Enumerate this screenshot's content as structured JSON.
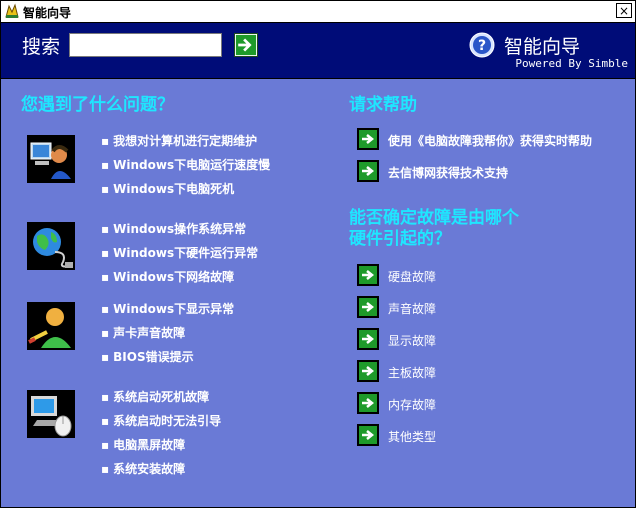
{
  "window": {
    "title": "智能向导",
    "close": "×"
  },
  "header": {
    "search_label": "搜索",
    "search_value": "",
    "search_placeholder": "",
    "brand": "智能向导",
    "powered_by": "Powered By Simble"
  },
  "problems": {
    "title": "您遇到了什么问题？",
    "groups": [
      {
        "items": [
          "我想对计算机进行定期维护",
          "Windows下电脑运行速度慢",
          "Windows下电脑死机"
        ]
      },
      {
        "items": [
          "Windows操作系统异常",
          "Windows下硬件运行异常",
          "Windows下网络故障"
        ]
      },
      {
        "items": [
          "Windows下显示异常",
          "声卡声音故障",
          "BIOS错误提示"
        ]
      },
      {
        "items": [
          "系统启动死机故障",
          "系统启动时无法引导",
          "电脑黑屏故障",
          "系统安装故障"
        ]
      }
    ]
  },
  "help": {
    "title": "请求帮助",
    "items": [
      "使用《电脑故障我帮你》获得实时帮助",
      "去信博网获得技术支持"
    ]
  },
  "hardware": {
    "title_line1": "能否确定故障是由哪个",
    "title_line2": "硬件引起的？",
    "items": [
      "硬盘故障",
      "声音故障",
      "显示故障",
      "主板故障",
      "内存故障",
      "其他类型"
    ]
  },
  "colors": {
    "header_bg": "#000c78",
    "main_bg": "#6a7ad6",
    "accent": "#1fe6ff",
    "arrow_green": "#1e9a2a"
  }
}
